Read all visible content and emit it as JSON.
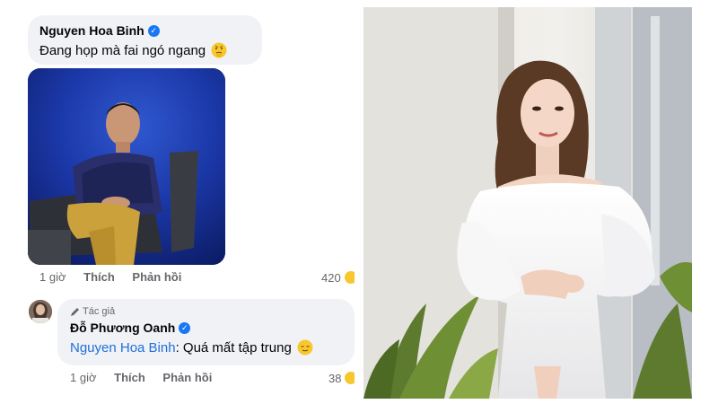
{
  "comment": {
    "author": "Nguyen Hoa Binh",
    "text": "Đang họp mà fai ngó ngang",
    "time": "1 giờ",
    "like_label": "Thích",
    "reply_label": "Phản hồi",
    "reaction_count": "420"
  },
  "reply": {
    "badge": "Tác giả",
    "author": "Đỗ Phương Oanh",
    "mention": "Nguyen Hoa Binh",
    "text": ": Quá mất tập trung",
    "time": "1 giờ",
    "like_label": "Thích",
    "reply_label": "Phản hồi",
    "reaction_count": "38"
  },
  "icons": {
    "verified": "verified-badge-icon",
    "pencil": "pencil-icon",
    "emoji": "smiley-emoji-icon"
  },
  "colors": {
    "bubble": "#f0f2f5",
    "accent": "#1877f2",
    "mention": "#216fdb",
    "meta": "#65676b"
  }
}
